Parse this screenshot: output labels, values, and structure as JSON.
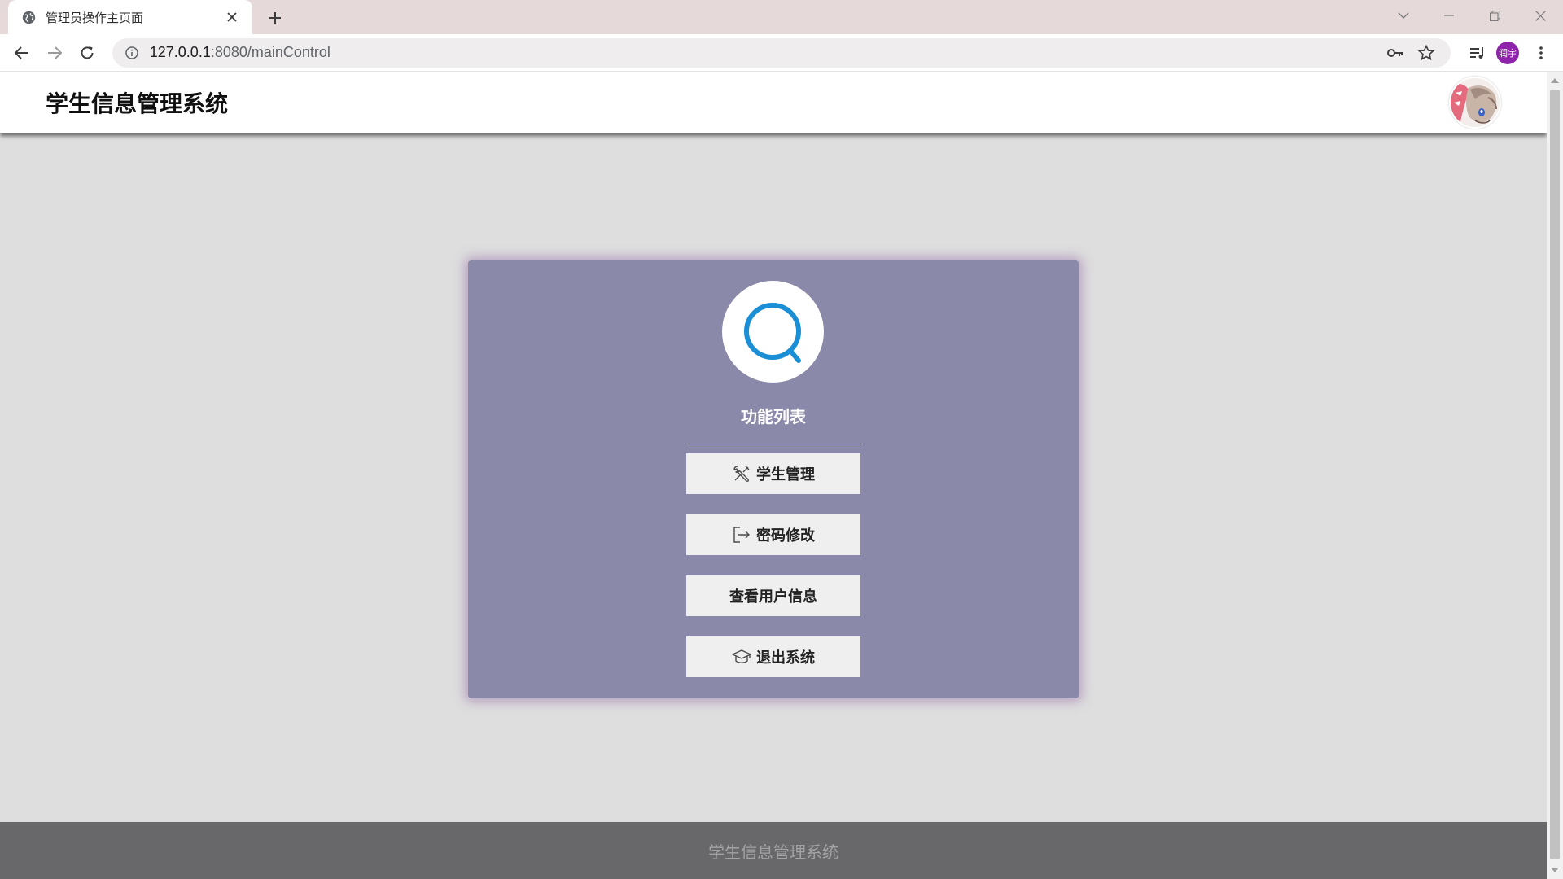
{
  "browser": {
    "tab": {
      "title": "管理员操作主页面"
    },
    "address": {
      "host": "127.0.0.1",
      "path": ":8080/mainControl"
    },
    "profile_label": "润宇"
  },
  "header": {
    "title": "学生信息管理系统"
  },
  "card": {
    "title": "功能列表",
    "buttons": [
      {
        "label": "学生管理",
        "icon": "tools-icon"
      },
      {
        "label": "密码修改",
        "icon": "exit-arrow-icon"
      },
      {
        "label": "查看用户信息",
        "icon": ""
      },
      {
        "label": "退出系统",
        "icon": "graduation-cap-icon"
      }
    ]
  },
  "footer": {
    "text": "学生信息管理系统"
  },
  "colors": {
    "tab_strip": "#e6d9da",
    "card_bg": "#8b89a9",
    "footer_bg": "#68686b",
    "logo_accent": "#1a8fd6",
    "profile_bg": "#8e24aa"
  }
}
